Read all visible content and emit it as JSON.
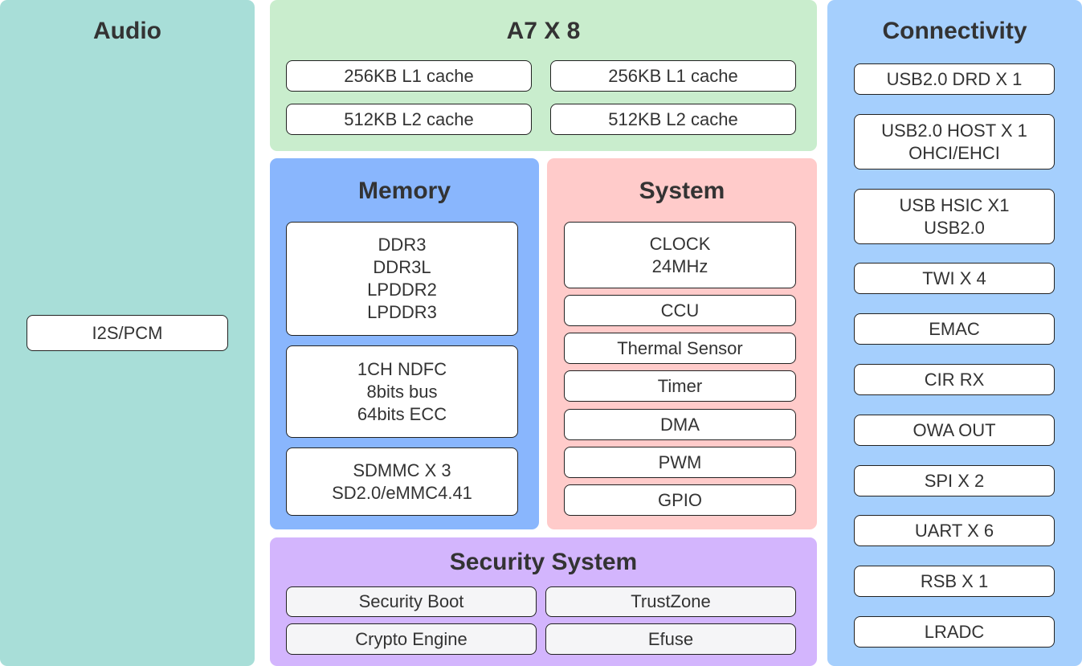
{
  "colors": {
    "audio": "#a8ded8",
    "cpu": "#c9edcd",
    "memory": "#89b6fd",
    "system": "#ffcbca",
    "security": "#d3b5fd",
    "connectivity": "#a5cffd"
  },
  "audio": {
    "title": "Audio",
    "items": [
      "I2S/PCM"
    ]
  },
  "cpu": {
    "title": "A7 X 8",
    "items": [
      "256KB L1 cache",
      "256KB L1 cache",
      "512KB L2 cache",
      "512KB L2 cache"
    ]
  },
  "memory": {
    "title": "Memory",
    "items": [
      "DDR3\nDDR3L\nLPDDR2\nLPDDR3",
      "1CH NDFC\n8bits bus\n64bits ECC",
      "SDMMC X 3\nSD2.0/eMMC4.41"
    ]
  },
  "system": {
    "title": "System",
    "items": [
      "CLOCK\n24MHz",
      "CCU",
      "Thermal Sensor",
      "Timer",
      "DMA",
      "PWM",
      "GPIO"
    ]
  },
  "security": {
    "title": "Security System",
    "items": [
      "Security Boot",
      "TrustZone",
      "Crypto Engine",
      "Efuse"
    ]
  },
  "connectivity": {
    "title": "Connectivity",
    "items": [
      "USB2.0 DRD X 1",
      "USB2.0 HOST X 1\nOHCI/EHCI",
      "USB HSIC X1\nUSB2.0",
      "TWI X 4",
      "EMAC",
      "CIR RX",
      "OWA OUT",
      "SPI X 2",
      "UART X 6",
      "RSB X 1",
      "LRADC"
    ]
  }
}
